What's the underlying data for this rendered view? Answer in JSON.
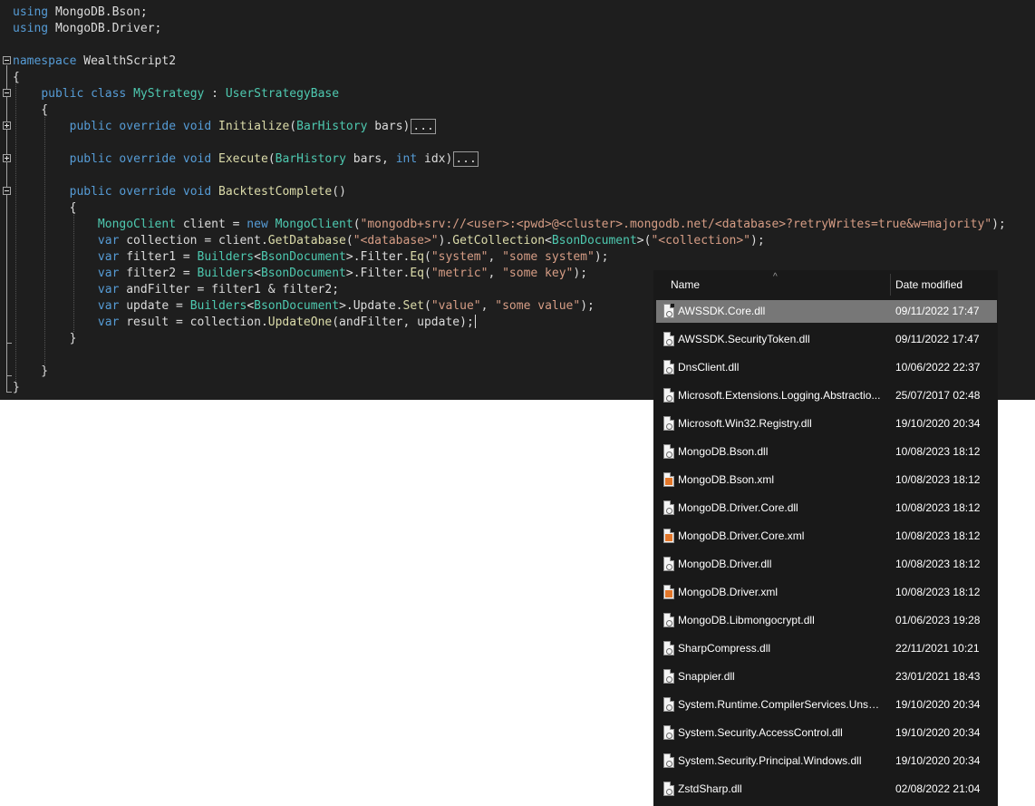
{
  "editor": {
    "lines": [
      [
        {
          "t": "using",
          "c": "kw"
        },
        {
          "t": " MongoDB.Bson;",
          "c": "pl"
        }
      ],
      [
        {
          "t": "using",
          "c": "kw"
        },
        {
          "t": " MongoDB.Driver;",
          "c": "pl"
        }
      ],
      [],
      [
        {
          "t": "namespace",
          "c": "kw"
        },
        {
          "t": " WealthScript2",
          "c": "pl"
        }
      ],
      [
        {
          "t": "{",
          "c": "pl"
        }
      ],
      [
        {
          "t": "    "
        },
        {
          "t": "public",
          "c": "kw"
        },
        {
          "t": " "
        },
        {
          "t": "class",
          "c": "kw"
        },
        {
          "t": " "
        },
        {
          "t": "MyStrategy",
          "c": "ty"
        },
        {
          "t": " : "
        },
        {
          "t": "UserStrategyBase",
          "c": "ty"
        }
      ],
      [
        {
          "t": "    {"
        }
      ],
      [
        {
          "t": "        "
        },
        {
          "t": "public",
          "c": "kw"
        },
        {
          "t": " "
        },
        {
          "t": "override",
          "c": "kw"
        },
        {
          "t": " "
        },
        {
          "t": "void",
          "c": "kw"
        },
        {
          "t": " "
        },
        {
          "t": "Initialize",
          "c": "fn"
        },
        {
          "t": "("
        },
        {
          "t": "BarHistory",
          "c": "ty"
        },
        {
          "t": " bars)"
        },
        {
          "t": "...",
          "c": "collapsed"
        }
      ],
      [],
      [
        {
          "t": "        "
        },
        {
          "t": "public",
          "c": "kw"
        },
        {
          "t": " "
        },
        {
          "t": "override",
          "c": "kw"
        },
        {
          "t": " "
        },
        {
          "t": "void",
          "c": "kw"
        },
        {
          "t": " "
        },
        {
          "t": "Execute",
          "c": "fn"
        },
        {
          "t": "("
        },
        {
          "t": "BarHistory",
          "c": "ty"
        },
        {
          "t": " bars, "
        },
        {
          "t": "int",
          "c": "kw"
        },
        {
          "t": " idx)"
        },
        {
          "t": "...",
          "c": "collapsed"
        }
      ],
      [],
      [
        {
          "t": "        "
        },
        {
          "t": "public",
          "c": "kw"
        },
        {
          "t": " "
        },
        {
          "t": "override",
          "c": "kw"
        },
        {
          "t": " "
        },
        {
          "t": "void",
          "c": "kw"
        },
        {
          "t": " "
        },
        {
          "t": "BacktestComplete",
          "c": "fn"
        },
        {
          "t": "()"
        }
      ],
      [
        {
          "t": "        {"
        }
      ],
      [
        {
          "t": "            "
        },
        {
          "t": "MongoClient",
          "c": "ty"
        },
        {
          "t": " client = "
        },
        {
          "t": "new",
          "c": "kw"
        },
        {
          "t": " "
        },
        {
          "t": "MongoClient",
          "c": "ty"
        },
        {
          "t": "("
        },
        {
          "t": "\"mongodb+srv://<user>:<pwd>@<cluster>.mongodb.net/<database>?retryWrites=true&w=majority\"",
          "c": "st"
        },
        {
          "t": ");"
        }
      ],
      [
        {
          "t": "            "
        },
        {
          "t": "var",
          "c": "kw"
        },
        {
          "t": " collection = client."
        },
        {
          "t": "GetDatabase",
          "c": "fn"
        },
        {
          "t": "("
        },
        {
          "t": "\"<database>\"",
          "c": "st"
        },
        {
          "t": ")."
        },
        {
          "t": "GetCollection",
          "c": "fn"
        },
        {
          "t": "<"
        },
        {
          "t": "BsonDocument",
          "c": "ty"
        },
        {
          "t": ">("
        },
        {
          "t": "\"<collection>\"",
          "c": "st"
        },
        {
          "t": ");"
        }
      ],
      [
        {
          "t": "            "
        },
        {
          "t": "var",
          "c": "kw"
        },
        {
          "t": " filter1 = "
        },
        {
          "t": "Builders",
          "c": "ty"
        },
        {
          "t": "<"
        },
        {
          "t": "BsonDocument",
          "c": "ty"
        },
        {
          "t": ">.Filter."
        },
        {
          "t": "Eq",
          "c": "fn"
        },
        {
          "t": "("
        },
        {
          "t": "\"system\"",
          "c": "st"
        },
        {
          "t": ", "
        },
        {
          "t": "\"some system\"",
          "c": "st"
        },
        {
          "t": ");"
        }
      ],
      [
        {
          "t": "            "
        },
        {
          "t": "var",
          "c": "kw"
        },
        {
          "t": " filter2 = "
        },
        {
          "t": "Builders",
          "c": "ty"
        },
        {
          "t": "<"
        },
        {
          "t": "BsonDocument",
          "c": "ty"
        },
        {
          "t": ">.Filter."
        },
        {
          "t": "Eq",
          "c": "fn"
        },
        {
          "t": "("
        },
        {
          "t": "\"metric\"",
          "c": "st"
        },
        {
          "t": ", "
        },
        {
          "t": "\"some key\"",
          "c": "st"
        },
        {
          "t": ");"
        }
      ],
      [
        {
          "t": "            "
        },
        {
          "t": "var",
          "c": "kw"
        },
        {
          "t": " andFilter = filter1 & filter2;"
        }
      ],
      [
        {
          "t": "            "
        },
        {
          "t": "var",
          "c": "kw"
        },
        {
          "t": " update = "
        },
        {
          "t": "Builders",
          "c": "ty"
        },
        {
          "t": "<"
        },
        {
          "t": "BsonDocument",
          "c": "ty"
        },
        {
          "t": ">.Update."
        },
        {
          "t": "Set",
          "c": "fn"
        },
        {
          "t": "("
        },
        {
          "t": "\"value\"",
          "c": "st"
        },
        {
          "t": ", "
        },
        {
          "t": "\"some value\"",
          "c": "st"
        },
        {
          "t": ");"
        }
      ],
      [
        {
          "t": "            "
        },
        {
          "t": "var",
          "c": "kw"
        },
        {
          "t": " result = collection."
        },
        {
          "t": "UpdateOne",
          "c": "fn"
        },
        {
          "t": "(andFilter, update);"
        },
        {
          "t": "",
          "c": "caret"
        }
      ],
      [
        {
          "t": "        }"
        }
      ],
      [],
      [
        {
          "t": "    }"
        }
      ],
      [
        {
          "t": "}"
        }
      ]
    ]
  },
  "explorer": {
    "columns": {
      "name": "Name",
      "date": "Date modified"
    },
    "files": [
      {
        "name": "AWSSDK.Core.dll",
        "date": "09/11/2022 17:47",
        "type": "dll",
        "selected": true
      },
      {
        "name": "AWSSDK.SecurityToken.dll",
        "date": "09/11/2022 17:47",
        "type": "dll"
      },
      {
        "name": "DnsClient.dll",
        "date": "10/06/2022 22:37",
        "type": "dll"
      },
      {
        "name": "Microsoft.Extensions.Logging.Abstractio...",
        "date": "25/07/2017 02:48",
        "type": "dll"
      },
      {
        "name": "Microsoft.Win32.Registry.dll",
        "date": "19/10/2020 20:34",
        "type": "dll"
      },
      {
        "name": "MongoDB.Bson.dll",
        "date": "10/08/2023 18:12",
        "type": "dll"
      },
      {
        "name": "MongoDB.Bson.xml",
        "date": "10/08/2023 18:12",
        "type": "xml"
      },
      {
        "name": "MongoDB.Driver.Core.dll",
        "date": "10/08/2023 18:12",
        "type": "dll"
      },
      {
        "name": "MongoDB.Driver.Core.xml",
        "date": "10/08/2023 18:12",
        "type": "xml"
      },
      {
        "name": "MongoDB.Driver.dll",
        "date": "10/08/2023 18:12",
        "type": "dll"
      },
      {
        "name": "MongoDB.Driver.xml",
        "date": "10/08/2023 18:12",
        "type": "xml"
      },
      {
        "name": "MongoDB.Libmongocrypt.dll",
        "date": "01/06/2023 19:28",
        "type": "dll"
      },
      {
        "name": "SharpCompress.dll",
        "date": "22/11/2021 10:21",
        "type": "dll"
      },
      {
        "name": "Snappier.dll",
        "date": "23/01/2021 18:43",
        "type": "dll"
      },
      {
        "name": "System.Runtime.CompilerServices.Unsaf...",
        "date": "19/10/2020 20:34",
        "type": "dll"
      },
      {
        "name": "System.Security.AccessControl.dll",
        "date": "19/10/2020 20:34",
        "type": "dll"
      },
      {
        "name": "System.Security.Principal.Windows.dll",
        "date": "19/10/2020 20:34",
        "type": "dll"
      },
      {
        "name": "ZstdSharp.dll",
        "date": "02/08/2022 21:04",
        "type": "dll"
      }
    ]
  }
}
